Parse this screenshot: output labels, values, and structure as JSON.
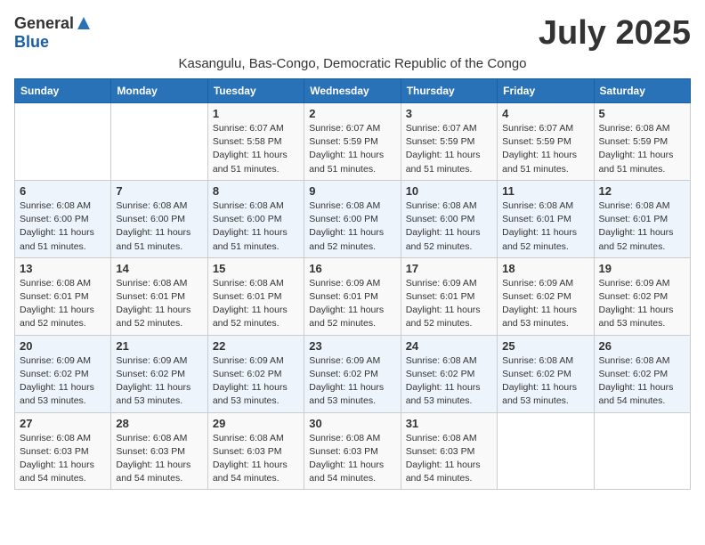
{
  "logo": {
    "general": "General",
    "blue": "Blue"
  },
  "month": "July 2025",
  "location": "Kasangulu, Bas-Congo, Democratic Republic of the Congo",
  "days_of_week": [
    "Sunday",
    "Monday",
    "Tuesday",
    "Wednesday",
    "Thursday",
    "Friday",
    "Saturday"
  ],
  "weeks": [
    [
      {
        "day": "",
        "info": ""
      },
      {
        "day": "",
        "info": ""
      },
      {
        "day": "1",
        "info": "Sunrise: 6:07 AM\nSunset: 5:58 PM\nDaylight: 11 hours and 51 minutes."
      },
      {
        "day": "2",
        "info": "Sunrise: 6:07 AM\nSunset: 5:59 PM\nDaylight: 11 hours and 51 minutes."
      },
      {
        "day": "3",
        "info": "Sunrise: 6:07 AM\nSunset: 5:59 PM\nDaylight: 11 hours and 51 minutes."
      },
      {
        "day": "4",
        "info": "Sunrise: 6:07 AM\nSunset: 5:59 PM\nDaylight: 11 hours and 51 minutes."
      },
      {
        "day": "5",
        "info": "Sunrise: 6:08 AM\nSunset: 5:59 PM\nDaylight: 11 hours and 51 minutes."
      }
    ],
    [
      {
        "day": "6",
        "info": "Sunrise: 6:08 AM\nSunset: 6:00 PM\nDaylight: 11 hours and 51 minutes."
      },
      {
        "day": "7",
        "info": "Sunrise: 6:08 AM\nSunset: 6:00 PM\nDaylight: 11 hours and 51 minutes."
      },
      {
        "day": "8",
        "info": "Sunrise: 6:08 AM\nSunset: 6:00 PM\nDaylight: 11 hours and 51 minutes."
      },
      {
        "day": "9",
        "info": "Sunrise: 6:08 AM\nSunset: 6:00 PM\nDaylight: 11 hours and 52 minutes."
      },
      {
        "day": "10",
        "info": "Sunrise: 6:08 AM\nSunset: 6:00 PM\nDaylight: 11 hours and 52 minutes."
      },
      {
        "day": "11",
        "info": "Sunrise: 6:08 AM\nSunset: 6:01 PM\nDaylight: 11 hours and 52 minutes."
      },
      {
        "day": "12",
        "info": "Sunrise: 6:08 AM\nSunset: 6:01 PM\nDaylight: 11 hours and 52 minutes."
      }
    ],
    [
      {
        "day": "13",
        "info": "Sunrise: 6:08 AM\nSunset: 6:01 PM\nDaylight: 11 hours and 52 minutes."
      },
      {
        "day": "14",
        "info": "Sunrise: 6:08 AM\nSunset: 6:01 PM\nDaylight: 11 hours and 52 minutes."
      },
      {
        "day": "15",
        "info": "Sunrise: 6:08 AM\nSunset: 6:01 PM\nDaylight: 11 hours and 52 minutes."
      },
      {
        "day": "16",
        "info": "Sunrise: 6:09 AM\nSunset: 6:01 PM\nDaylight: 11 hours and 52 minutes."
      },
      {
        "day": "17",
        "info": "Sunrise: 6:09 AM\nSunset: 6:01 PM\nDaylight: 11 hours and 52 minutes."
      },
      {
        "day": "18",
        "info": "Sunrise: 6:09 AM\nSunset: 6:02 PM\nDaylight: 11 hours and 53 minutes."
      },
      {
        "day": "19",
        "info": "Sunrise: 6:09 AM\nSunset: 6:02 PM\nDaylight: 11 hours and 53 minutes."
      }
    ],
    [
      {
        "day": "20",
        "info": "Sunrise: 6:09 AM\nSunset: 6:02 PM\nDaylight: 11 hours and 53 minutes."
      },
      {
        "day": "21",
        "info": "Sunrise: 6:09 AM\nSunset: 6:02 PM\nDaylight: 11 hours and 53 minutes."
      },
      {
        "day": "22",
        "info": "Sunrise: 6:09 AM\nSunset: 6:02 PM\nDaylight: 11 hours and 53 minutes."
      },
      {
        "day": "23",
        "info": "Sunrise: 6:09 AM\nSunset: 6:02 PM\nDaylight: 11 hours and 53 minutes."
      },
      {
        "day": "24",
        "info": "Sunrise: 6:08 AM\nSunset: 6:02 PM\nDaylight: 11 hours and 53 minutes."
      },
      {
        "day": "25",
        "info": "Sunrise: 6:08 AM\nSunset: 6:02 PM\nDaylight: 11 hours and 53 minutes."
      },
      {
        "day": "26",
        "info": "Sunrise: 6:08 AM\nSunset: 6:02 PM\nDaylight: 11 hours and 54 minutes."
      }
    ],
    [
      {
        "day": "27",
        "info": "Sunrise: 6:08 AM\nSunset: 6:03 PM\nDaylight: 11 hours and 54 minutes."
      },
      {
        "day": "28",
        "info": "Sunrise: 6:08 AM\nSunset: 6:03 PM\nDaylight: 11 hours and 54 minutes."
      },
      {
        "day": "29",
        "info": "Sunrise: 6:08 AM\nSunset: 6:03 PM\nDaylight: 11 hours and 54 minutes."
      },
      {
        "day": "30",
        "info": "Sunrise: 6:08 AM\nSunset: 6:03 PM\nDaylight: 11 hours and 54 minutes."
      },
      {
        "day": "31",
        "info": "Sunrise: 6:08 AM\nSunset: 6:03 PM\nDaylight: 11 hours and 54 minutes."
      },
      {
        "day": "",
        "info": ""
      },
      {
        "day": "",
        "info": ""
      }
    ]
  ]
}
